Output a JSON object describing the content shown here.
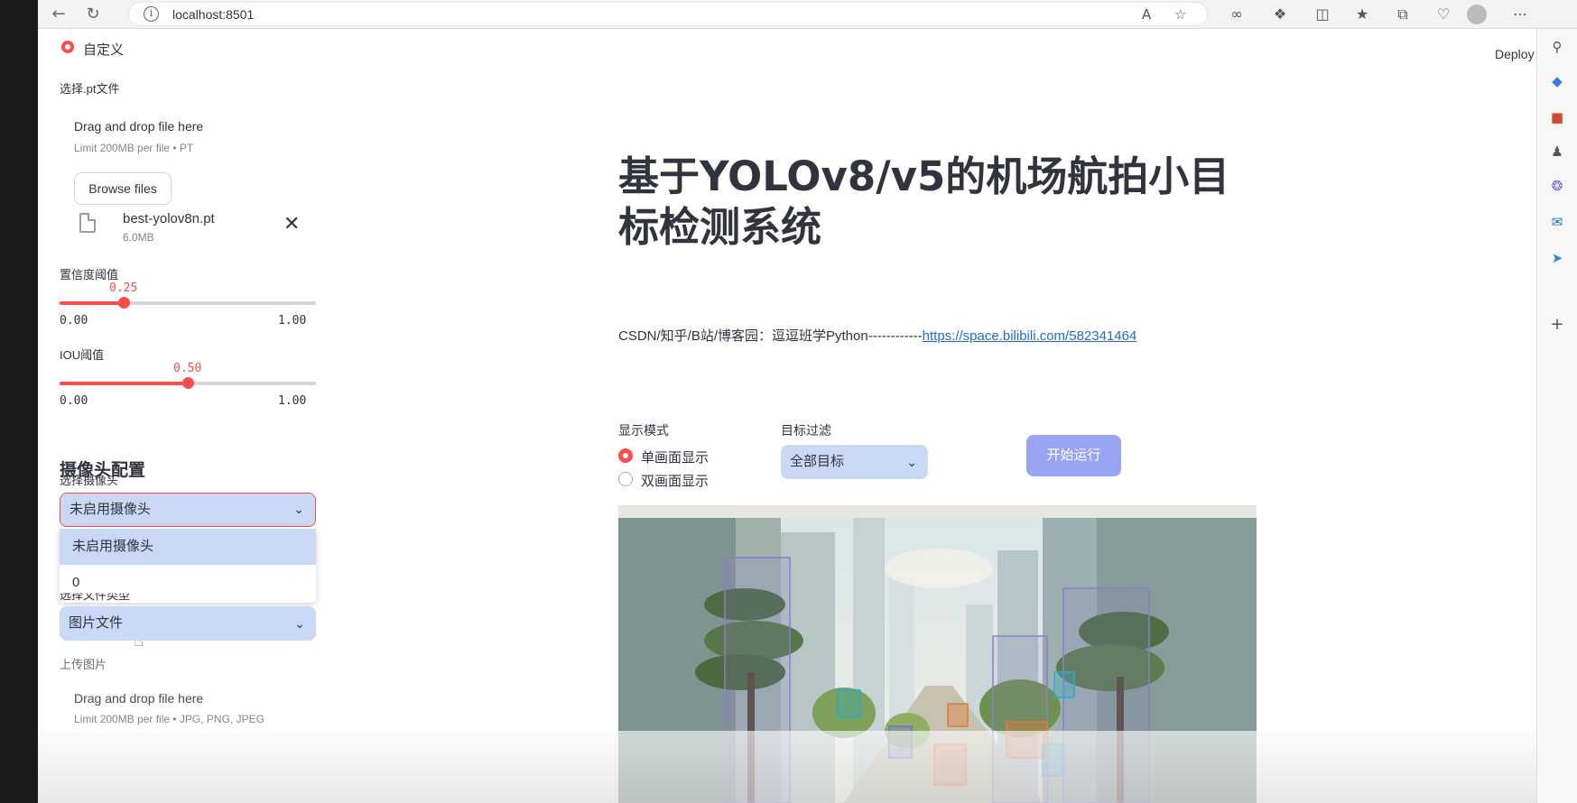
{
  "browser": {
    "url": "localhost:8501"
  },
  "sidebar": {
    "mode_label": "自定义",
    "pt_label": "选择.pt文件",
    "dropzone_text": "Drag and drop file here",
    "dropzone_limit": "Limit 200MB per file • PT",
    "browse_label": "Browse files",
    "file_name": "best-yolov8n.pt",
    "file_size": "6.0MB",
    "conf_label": "置信度阈值",
    "conf_value": "0.25",
    "conf_fraction": 0.25,
    "conf_min": "0.00",
    "conf_max": "1.00",
    "iou_label": "IOU阈值",
    "iou_value": "0.50",
    "iou_fraction": 0.5,
    "iou_min": "0.00",
    "iou_max": "1.00",
    "camera_heading": "摄像头配置",
    "camera_label": "选择摄像头",
    "camera_value": "未启用摄像头",
    "camera_options": [
      "未启用摄像头",
      "0"
    ],
    "filetype_label": "选择文件类型",
    "filetype_value": "图片文件",
    "upload_label": "上传图片",
    "upload_dropzone": "Drag and drop file here",
    "upload_limit": "Limit 200MB per file • JPG, PNG, JPEG"
  },
  "main": {
    "deploy_label": "Deploy",
    "title": "基于YOLOv8/v5的机场航拍小目标检测系统",
    "credit_text": "CSDN/知乎/B站/博客园：逗逗班学Python------------",
    "credit_link": "https://space.bilibili.com/582341464",
    "display_mode_label": "显示模式",
    "display_options": [
      "单画面显示",
      "双画面显示"
    ],
    "filter_label": "目标过滤",
    "filter_value": "全部目标",
    "run_label": "开始运行"
  },
  "colors": {
    "accent": "#ff4b4b",
    "select_bg": "#c9d9f5",
    "run_button": "#99a4f2",
    "link": "#1f6bd8"
  }
}
